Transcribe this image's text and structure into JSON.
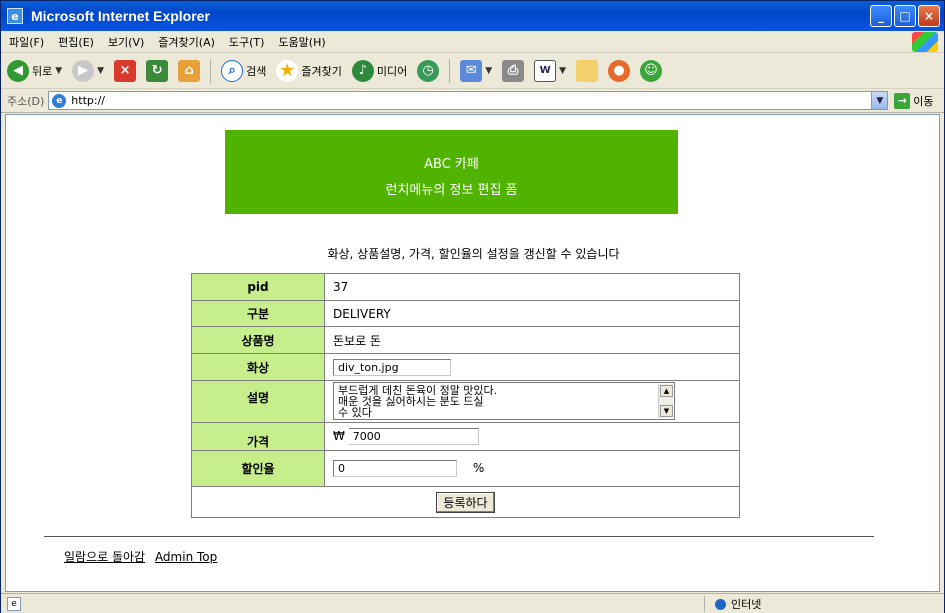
{
  "window": {
    "title": "Microsoft Internet Explorer"
  },
  "menu": [
    "파일(F)",
    "편집(E)",
    "보기(V)",
    "즐겨찾기(A)",
    "도구(T)",
    "도움말(H)"
  ],
  "toolbar": {
    "back": "뒤로",
    "search": "검색",
    "favorites": "즐겨찾기",
    "media": "미디어"
  },
  "address": {
    "label": "주소(D)",
    "url": "http://",
    "go": "이동"
  },
  "page": {
    "banner_line1": "ABC 카페",
    "banner_line2": "런치메뉴의 정보 편집 폼",
    "instruction": "화상, 상품설명, 가격, 할인율의 설정을 갱신할 수 있습니다",
    "fields": {
      "pid_label": "pid",
      "pid_value": "37",
      "category_label": "구분",
      "category_value": "DELIVERY",
      "name_label": "상품명",
      "name_value": "돈보로 돈",
      "image_label": "화상",
      "image_value": "div_ton.jpg",
      "desc_label": "설명",
      "desc_line1": "부드럽게 데친 돈육이 정말 맛있다.",
      "desc_line2": "매운 것을 싫어하시는 분도 드실",
      "desc_line3": "수 있다",
      "price_label": "가격",
      "price_currency": "₩",
      "price_value": "7000",
      "discount_label": "할인율",
      "discount_value": "0",
      "discount_unit": "%"
    },
    "submit": "등록하다",
    "links": {
      "back_to_list": "일람으로 돌아감",
      "admin_top": "Admin Top"
    }
  },
  "status": {
    "zone": "인터넷"
  }
}
